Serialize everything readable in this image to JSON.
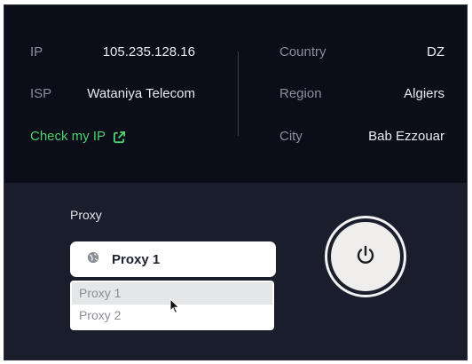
{
  "info": {
    "ip_label": "IP",
    "ip_value": "105.235.128.16",
    "isp_label": "ISP",
    "isp_value": "Wataniya Telecom",
    "check_label": "Check my IP",
    "country_label": "Country",
    "country_value": "DZ",
    "region_label": "Region",
    "region_value": "Algiers",
    "city_label": "City",
    "city_value": "Bab Ezzouar"
  },
  "proxy": {
    "label": "Proxy",
    "selected": "Proxy 1",
    "options": [
      "Proxy 1",
      "Proxy 2"
    ],
    "highlighted_option": "Proxy 1"
  },
  "icons": {
    "external_link": "external-link-icon",
    "globe": "globe-icon",
    "power": "power-icon",
    "cursor": "mouse-cursor-icon"
  },
  "colors": {
    "accent_green": "#4ccf6c",
    "header_bg": "#0b0d18",
    "panel_bg": "#1a1e2c"
  }
}
